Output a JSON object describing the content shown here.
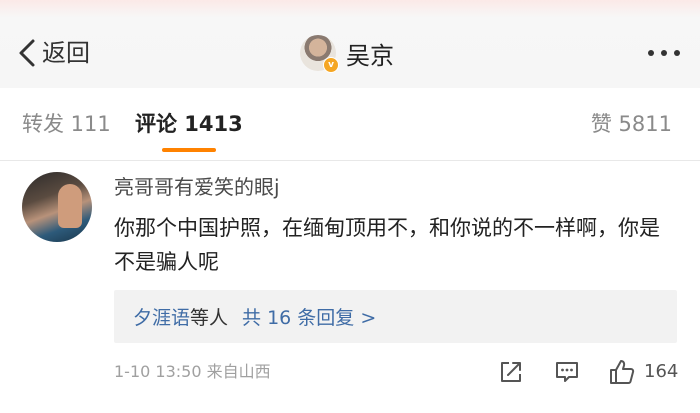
{
  "header": {
    "back_label": "返回",
    "title": "吴京",
    "verify_mark": "v"
  },
  "tabs": {
    "repost": "转发 111",
    "comment": "评论 1413",
    "like": "赞 5811"
  },
  "comment": {
    "username": "亮哥哥有爱笑的眼j",
    "text": "你那个中国护照，在缅甸顶用不，和你说的不一样啊，你是不是骗人呢",
    "replies": {
      "names": "夕涯语",
      "suffix": "等人",
      "count_label": "共 16 条回复 >"
    },
    "meta": "1-10 13:50  来自山西",
    "like_count": "164"
  },
  "icons": {
    "back": "chevron-left-icon",
    "more": "more-dots-icon",
    "share": "share-icon",
    "comment": "comment-icon",
    "like": "thumbs-up-icon"
  },
  "colors": {
    "accent": "#ff8200",
    "link": "#3f6ca6",
    "muted": "#a0a0a0",
    "verified": "#f5a623"
  }
}
